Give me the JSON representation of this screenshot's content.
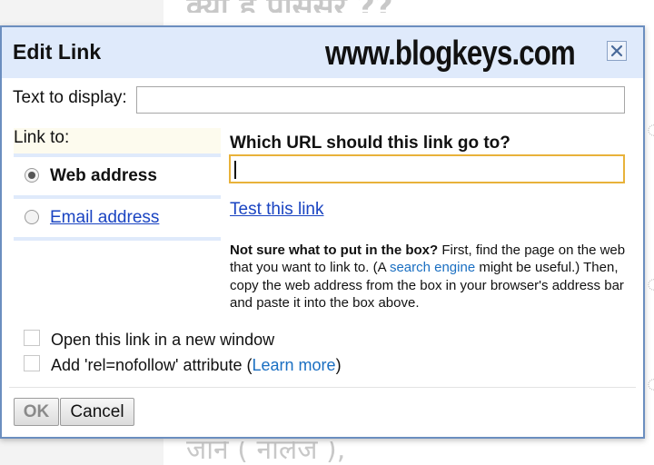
{
  "background": {
    "heading": "क्या है प्रोसेसर ??",
    "footer": "जानें ( नॉलेज ),",
    "right_fragments": [
      "ा",
      "ा",
      "ा",
      "ा"
    ]
  },
  "dialog": {
    "title": "Edit Link",
    "watermark": "www.blogkeys.com",
    "close_icon": "close-icon",
    "text_to_display_label": "Text to display:",
    "text_to_display_value": "",
    "link_to_label": "Link to:",
    "link_options": [
      {
        "label": "Web address",
        "selected": true
      },
      {
        "label": "Email address",
        "selected": false
      }
    ],
    "url_heading": "Which URL should this link go to?",
    "url_value": "",
    "test_link": "Test this link",
    "help": {
      "bold": "Not sure what to put in the box?",
      "part1": " First, find the page on the web that you want to link to. (A ",
      "link": "search engine",
      "part2": " might be useful.) Then, copy the web address from the box in your browser's address bar and paste it into the box above."
    },
    "options": {
      "new_window": "Open this link in a new window",
      "nofollow_prefix": "Add 'rel=nofollow' attribute (",
      "nofollow_link": "Learn more",
      "nofollow_suffix": ")"
    },
    "buttons": {
      "ok": "OK",
      "cancel": "Cancel"
    },
    "colors": {
      "header_bg": "#dfeafb",
      "link": "#1a44c2",
      "focus_border": "#e8b23a",
      "border": "#6b8ebf"
    }
  }
}
